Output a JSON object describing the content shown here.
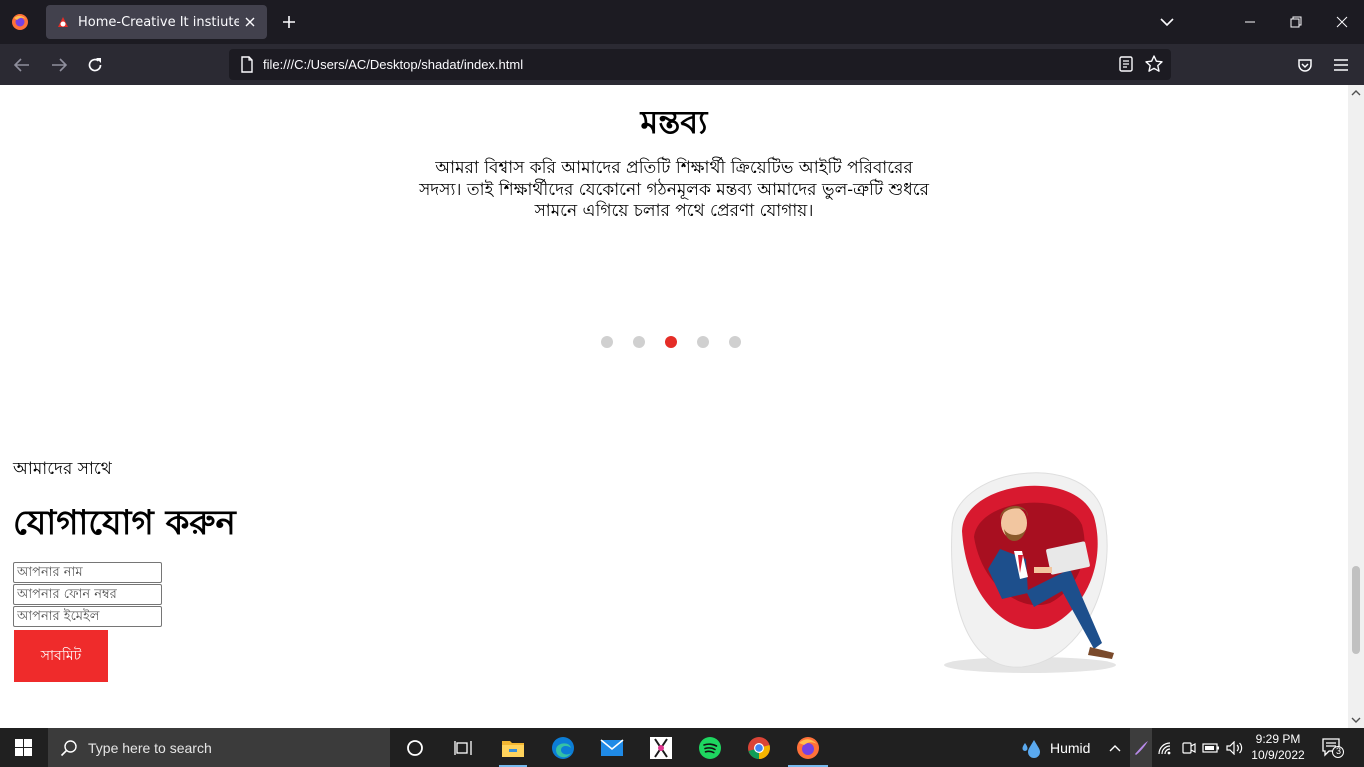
{
  "browser": {
    "tab_title": "Home-Creative It instiute",
    "url": "file:///C:/Users/AC/Desktop/shadat/index.html"
  },
  "page": {
    "testimonial": {
      "title": "মন্তব্য",
      "text": "আমরা বিশ্বাস করি আমাদের প্রতিটি শিক্ষার্থী ক্রিয়েটিভ আইটি পরিবারের সদস্য। তাই শিক্ষার্থীদের যেকোনো গঠনমূলক মন্তব্য আমাদের ভুল-ত্রুটি শুধরে সামনে এগিয়ে চলার পথে প্রেরণা যোগায়।",
      "slide_count": 5,
      "active_slide": 3,
      "active_color": "#e52d27"
    },
    "contact": {
      "kicker": "আমাদের সাথে",
      "title": "যোগাযোগ করুন",
      "name_placeholder": "আপনার নাম",
      "phone_placeholder": "আপনার ফোন নম্বর",
      "email_placeholder": "আপনার ইমেইল",
      "submit_label": "সাবমিট",
      "submit_color": "#ef2b2b"
    }
  },
  "taskbar": {
    "search_placeholder": "Type here to search",
    "weather_label": "Humid",
    "time": "9:29 PM",
    "date": "10/9/2022",
    "notification_count": "3"
  }
}
